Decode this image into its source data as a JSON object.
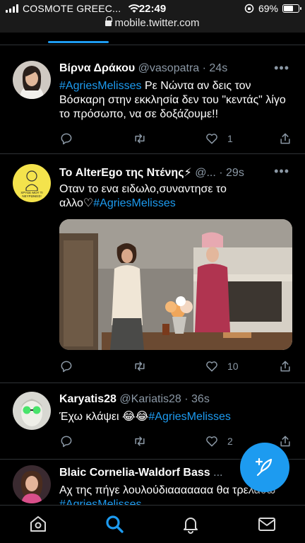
{
  "status_bar": {
    "carrier": "COSMOTE GREEC...",
    "time": "22:49",
    "battery": "69%",
    "battery_level": 0.69
  },
  "browser": {
    "url": "mobile.twitter.com"
  },
  "tweets": [
    {
      "name": "Βίρνα Δράκου",
      "handle": "@vasopatra",
      "time": "24s",
      "text_plain": "Ρε Νώντα αν δεις τον Βόσκαρη στην εκκλησία δεν του \"κεντάς\" λίγο το πρόσωπο, να σε δοξάζουμε!!",
      "hashtag": "#AgriesMelisses",
      "reply_count": "",
      "retweet_count": "",
      "like_count": "1"
    },
    {
      "name": "Το AlterEgo της Ντένης⚡",
      "handle": "@...",
      "time": "29s",
      "text_plain": "Οταν το ενα ειδωλο,συναντησε το αλλο♡",
      "hashtag": "#AgriesMelisses",
      "avatar_caption": "ΧΡΥΣΕ ΜΟΥ ΤΙ ΝΕΥΡΩΝΕΙΣ!",
      "like_count": "10"
    },
    {
      "name": "Karyatis28",
      "handle": "@Kariatis28",
      "time": "36s",
      "text_plain": "Έχω κλάψει 😂😂",
      "hashtag": "#AgriesMelisses",
      "like_count": "2"
    },
    {
      "name": "Blaic Cornelia-Waldorf Bass",
      "handle": "...",
      "text_plain": "Αχ της πήγε λουλούδιααααααα θα τρελαθω",
      "hashtag": "#AgriesMelisses"
    }
  ],
  "icons": {
    "reply": "reply-icon",
    "retweet": "retweet-icon",
    "like": "heart-icon",
    "share": "share-icon",
    "more": "more-icon",
    "compose": "compose-icon",
    "home": "home-icon",
    "search": "search-icon",
    "notifications": "bell-icon",
    "messages": "mail-icon"
  },
  "colors": {
    "accent": "#1d9bf0",
    "background": "#000000",
    "muted": "#8b98a5",
    "divider": "#2f3336"
  }
}
